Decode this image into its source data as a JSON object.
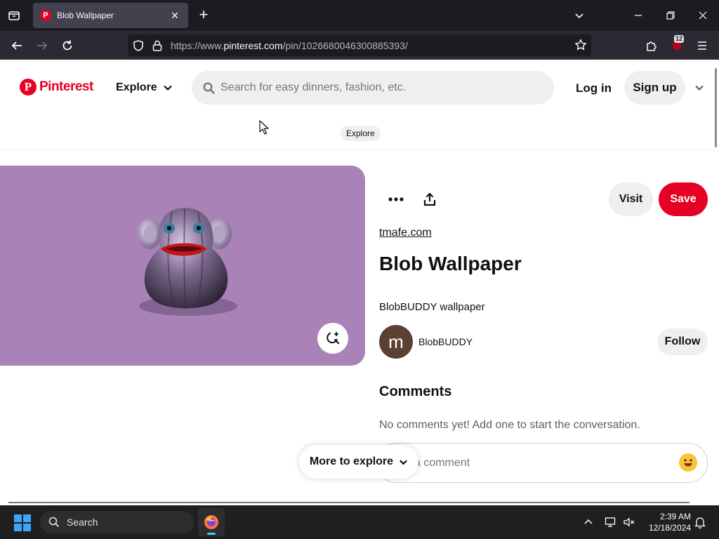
{
  "browser": {
    "tab_title": "Blob Wallpaper",
    "favicon_letter": "P",
    "url_prefix": "https://www.",
    "url_host": "pinterest.com",
    "url_path": "/pin/1026680046300885393/",
    "extension_badge": "12"
  },
  "header": {
    "logo_letter": "P",
    "logo_text": "Pinterest",
    "explore_label": "Explore",
    "search_placeholder": "Search for easy dinners, fashion, etc.",
    "login_label": "Log in",
    "signup_label": "Sign up",
    "tooltip": "Explore"
  },
  "pin": {
    "visit_label": "Visit",
    "save_label": "Save",
    "source": "tmafe.com",
    "title": "Blob Wallpaper",
    "description": "BlobBUDDY wallpaper",
    "creator_initial": "m",
    "creator_name": "BlobBUDDY",
    "follow_label": "Follow",
    "comments_heading": "Comments",
    "no_comments": "No comments yet! Add one to start the conversation.",
    "comment_placeholder": "Add a comment",
    "more_to_explore": "More to explore"
  },
  "taskbar": {
    "search_label": "Search",
    "time": "2:39 AM",
    "date": "12/18/2024"
  },
  "colors": {
    "brand": "#e60023",
    "image_bg": "#a983b8"
  }
}
